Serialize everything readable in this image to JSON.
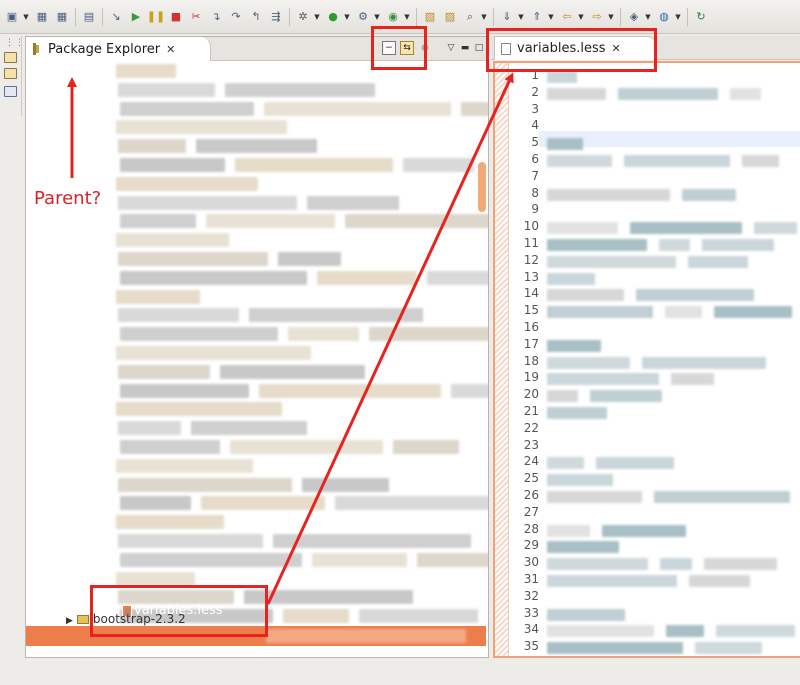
{
  "toolbar": {
    "icons": [
      "new-icon",
      "save-icon",
      "save-all-icon",
      "terminal-icon",
      "skip-breakpoints-icon",
      "resume-icon",
      "suspend-icon",
      "terminate-icon",
      "disconnect-icon",
      "step-into-icon",
      "step-over-icon",
      "step-return-icon",
      "use-step-filters-icon",
      "debug-icon",
      "run-icon",
      "external-tools-icon",
      "coverage-icon",
      "open-type-icon",
      "open-task-icon",
      "search-icon",
      "next-annotation-icon",
      "previous-annotation-icon",
      "back-icon",
      "forward-icon",
      "perspective-icon",
      "globe-icon",
      "refresh-icon"
    ]
  },
  "package_explorer": {
    "tab_label": "Package Explorer",
    "close_glyph": "✕",
    "selected_item": "variables.less",
    "bottom_item": "bootstrap-2.3.2"
  },
  "editor": {
    "tab_label": "variables.less",
    "close_glyph": "✕",
    "line_numbers": [
      "1",
      "2",
      "3",
      "4",
      "5",
      "6",
      "7",
      "8",
      "9",
      "10",
      "11",
      "12",
      "13",
      "14",
      "15",
      "16",
      "17",
      "18",
      "19",
      "20",
      "21",
      "22",
      "23",
      "24",
      "25",
      "26",
      "27",
      "28",
      "29",
      "30",
      "31",
      "32",
      "33",
      "34",
      "35"
    ]
  },
  "annotations": {
    "parent_label": "Parent?",
    "color": "#e8231f"
  },
  "colors": {
    "selection": "#ee7d4c",
    "editor_border": "#f0a27d",
    "current_line": "#e9f0fb"
  }
}
